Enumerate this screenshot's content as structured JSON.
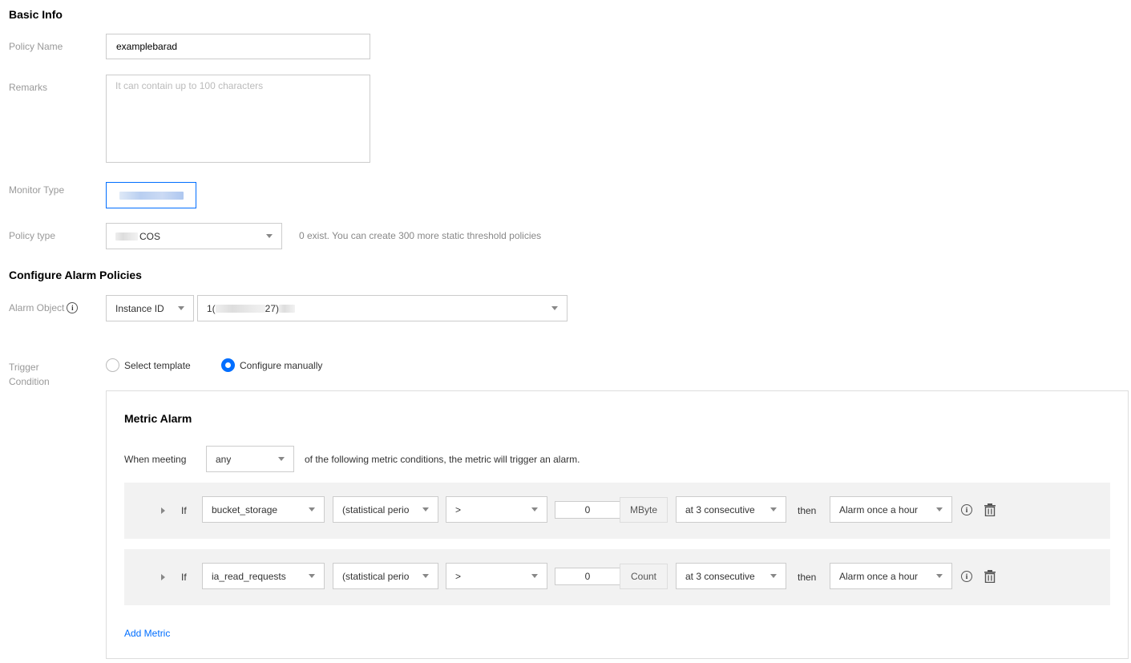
{
  "basic_info": {
    "title": "Basic Info",
    "policy_name_label": "Policy Name",
    "policy_name_value": "examplebarad",
    "remarks_label": "Remarks",
    "remarks_placeholder": "It can contain up to 100 characters",
    "monitor_type_label": "Monitor Type",
    "policy_type_label": "Policy type",
    "policy_type_value": "COS",
    "policy_type_hint": "0 exist. You can create 300 more static threshold policies"
  },
  "alarm_policies": {
    "title": "Configure Alarm Policies",
    "alarm_object_label": "Alarm Object",
    "alarm_object_type": "Instance ID",
    "alarm_object_value_prefix": "1(",
    "alarm_object_value_suffix": "27)",
    "trigger_label_line1": "Trigger",
    "trigger_label_line2": "Condition",
    "radio_template": "Select template",
    "radio_manual": "Configure manually"
  },
  "metric_alarm": {
    "title": "Metric Alarm",
    "when_meeting": "When meeting",
    "match_mode": "any",
    "suffix_text": "of the following metric conditions, the metric will trigger an alarm.",
    "add_metric": "Add Metric",
    "rows": [
      {
        "if_label": "If",
        "metric": "bucket_storage",
        "period": "(statistical perio",
        "operator": ">",
        "threshold": "0",
        "unit": "MByte",
        "consecutive": "at 3 consecutive",
        "then_label": "then",
        "frequency": "Alarm once a hour"
      },
      {
        "if_label": "If",
        "metric": "ia_read_requests",
        "period": "(statistical perio",
        "operator": ">",
        "threshold": "0",
        "unit": "Count",
        "consecutive": "at 3 consecutive",
        "then_label": "then",
        "frequency": "Alarm once a hour"
      }
    ]
  },
  "colors": {
    "accent": "#006eff",
    "row_bg": "#f2f2f2",
    "label": "#999999",
    "border": "#cccccc"
  }
}
